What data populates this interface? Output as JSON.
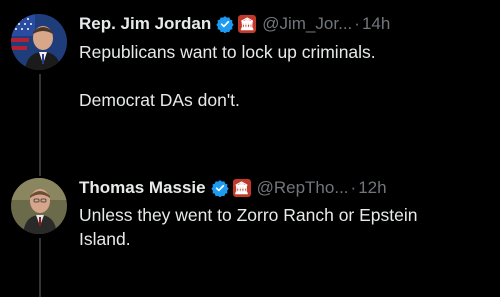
{
  "tweets": [
    {
      "name": "Rep. Jim Jordan",
      "handle": "@Jim_Jor...",
      "dot": "·",
      "time": "14h",
      "gov_badge": "🏛",
      "lines": [
        "Republicans want to lock up criminals.",
        "Democrat DAs don't."
      ]
    },
    {
      "name": "Thomas Massie",
      "handle": "@RepTho...",
      "dot": "·",
      "time": "12h",
      "gov_badge": "🏛",
      "lines": [
        "Unless they went to Zorro Ranch or Epstein",
        "Island."
      ]
    }
  ],
  "colors": {
    "background": "#000000",
    "text": "#e7e9ea",
    "muted": "#71767b",
    "verified": "#1d9bf0",
    "gov_badge": "#c0392b",
    "thread_line": "#333639"
  },
  "icons": {
    "verified": "verified-badge-icon",
    "government": "government-badge-icon"
  }
}
